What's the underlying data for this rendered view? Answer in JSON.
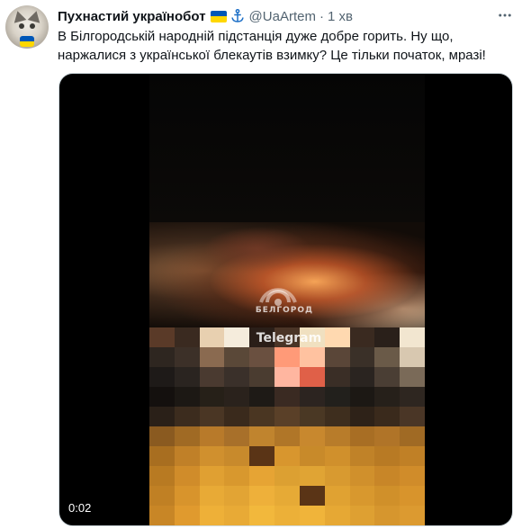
{
  "tweet": {
    "display_name": "Пухнастий українобот",
    "handle": "@UaArtem",
    "separator": "·",
    "time": "1 хв",
    "text": "В Білгородській народній підстанція дуже добре горить. Ну що, наржалися з української блекаутів взимку? Це тільки початок, мразі!"
  },
  "icons": {
    "verified_flag": "ukraine-flag-icon",
    "anchor": "anchor-icon",
    "more": "more-options-icon"
  },
  "media": {
    "type": "video",
    "duration": "0:02",
    "watermark_caption": "БЕЛГОРОД",
    "watermark_source": "Telegram"
  },
  "colors": {
    "text_primary": "#0f1419",
    "text_secondary": "#536471",
    "flag_blue": "#0057b7",
    "flag_yellow": "#ffd700",
    "anchor_blue": "#1d6fc7"
  }
}
